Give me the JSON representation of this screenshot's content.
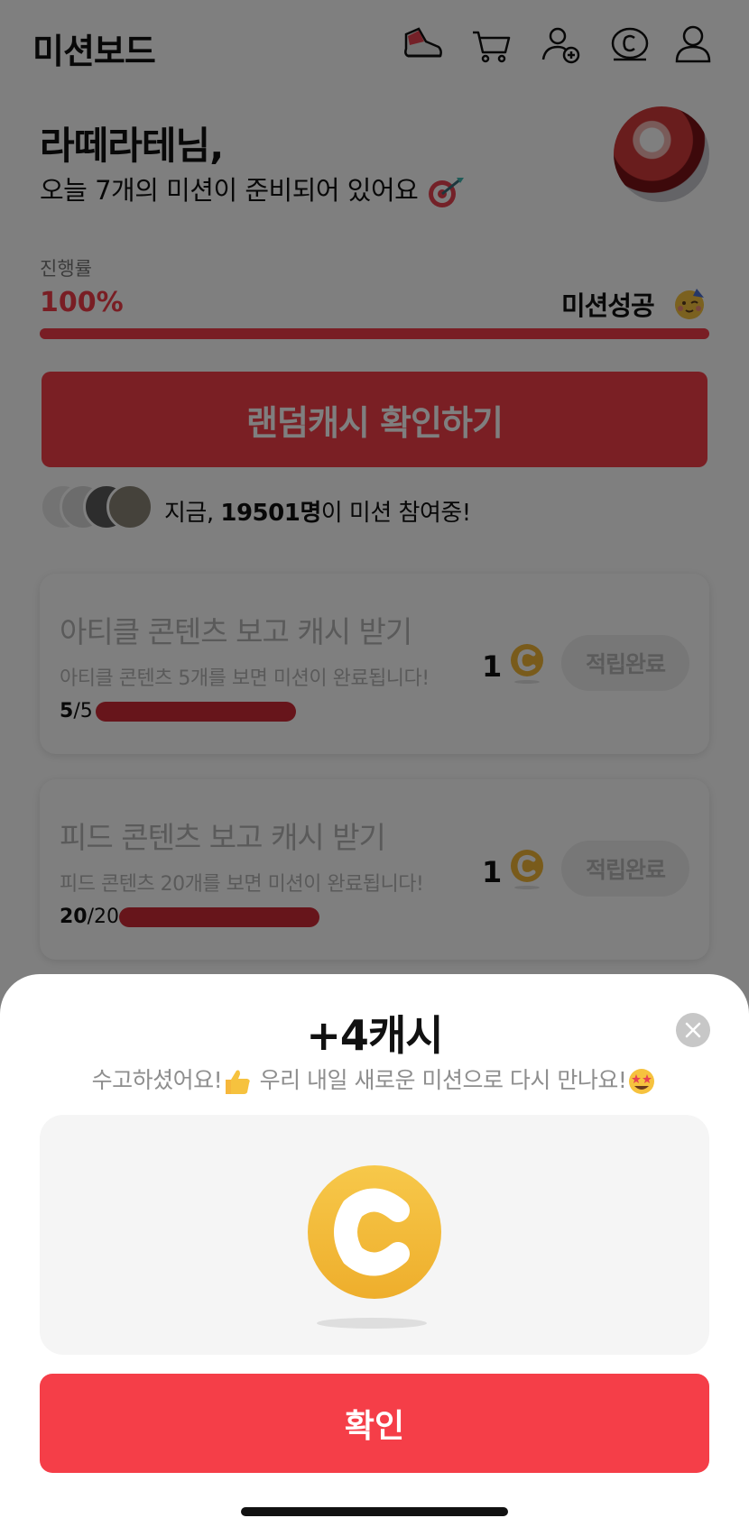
{
  "header": {
    "title": "미션보드",
    "icons": [
      "sneaker-icon",
      "cart-icon",
      "add-friend-icon",
      "cash-icon",
      "profile-icon"
    ]
  },
  "greeting": {
    "name": "라떼라테님,",
    "subtitle": "오늘 7개의 미션이 준비되어 있어요"
  },
  "progress": {
    "label": "진행률",
    "value_text": "100%",
    "fraction": 1.0,
    "status": "미션성공"
  },
  "random_cash_button": "랜덤캐시 확인하기",
  "participants": {
    "prefix": "지금, ",
    "count": "19501명",
    "suffix": "이 미션 참여중!"
  },
  "missions": [
    {
      "title": "아티클 콘텐츠 보고 캐시 받기",
      "description": "아티클 콘텐츠 5개를 보면 미션이 완료됩니다!",
      "done": "5",
      "total": "/5",
      "fraction": 1.0,
      "reward": "1",
      "button": "적립완료"
    },
    {
      "title": "피드 콘텐츠 보고 캐시 받기",
      "description": "피드 콘텐츠 20개를 보면 미션이 완료됩니다!",
      "done": "20",
      "total": "/20",
      "fraction": 1.0,
      "reward": "1",
      "button": "적립완료"
    }
  ],
  "sheet": {
    "title": "+4캐시",
    "message_part1": "수고하셨어요!",
    "message_part2": " 우리 내일 새로운 미션으로 다시 만나요!",
    "confirm": "확인"
  },
  "colors": {
    "accent": "#f53e48",
    "coin": "#f2b736"
  }
}
